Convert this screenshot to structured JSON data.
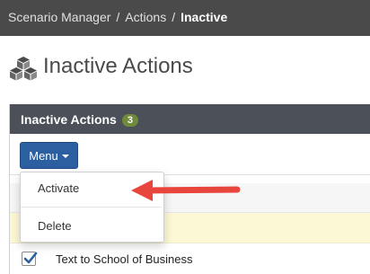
{
  "breadcrumb": {
    "items": [
      "Scenario Manager",
      "Actions"
    ],
    "current": "Inactive",
    "separator": "/"
  },
  "page": {
    "title": "Inactive Actions",
    "icon": "cubes-icon"
  },
  "panel": {
    "title": "Inactive Actions",
    "count": "3"
  },
  "toolbar": {
    "menu_label": "Menu"
  },
  "dropdown": {
    "items": [
      "Activate",
      "Delete"
    ]
  },
  "rows": [
    {
      "label": "Text to School of Business",
      "checked": true
    }
  ],
  "colors": {
    "topbar": "#4a4a4a",
    "panel_header": "#4c5159",
    "badge": "#6f8a3a",
    "menu_button": "#2c5fa0",
    "highlight_row": "#fcf8d6",
    "annotation_arrow": "#e8453c"
  }
}
